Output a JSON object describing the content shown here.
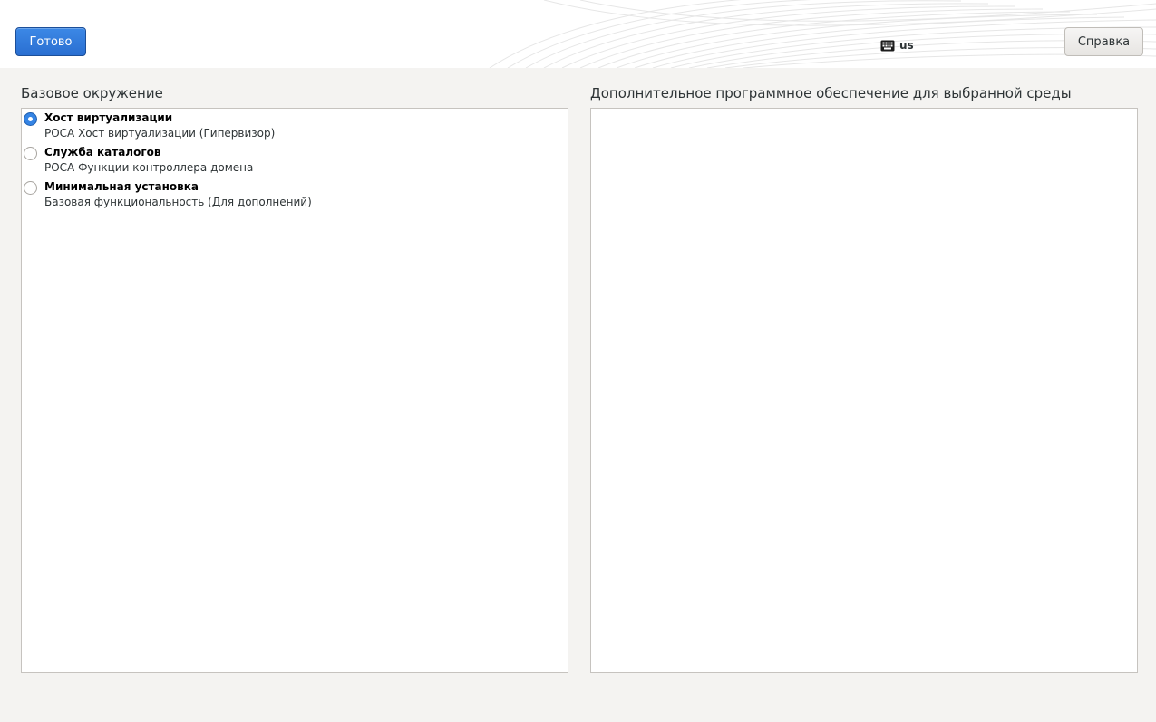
{
  "header": {
    "done_label": "Готово",
    "help_label": "Справка",
    "keyboard_layout": "us"
  },
  "left": {
    "title": "Базовое окружение",
    "environments": [
      {
        "name": "Хост виртуализации",
        "description": "РОСА Хост виртуализации (Гипервизор)",
        "selected": true
      },
      {
        "name": "Служба каталогов",
        "description": "РОСА Функции контроллера домена",
        "selected": false
      },
      {
        "name": "Минимальная установка",
        "description": "Базовая функциональность (Для дополнений)",
        "selected": false
      }
    ]
  },
  "right": {
    "title": "Дополнительное программное обеспечение для выбранной среды"
  },
  "colors": {
    "accent": "#3584e4",
    "background": "#f4f3f1",
    "panel": "#ffffff"
  }
}
